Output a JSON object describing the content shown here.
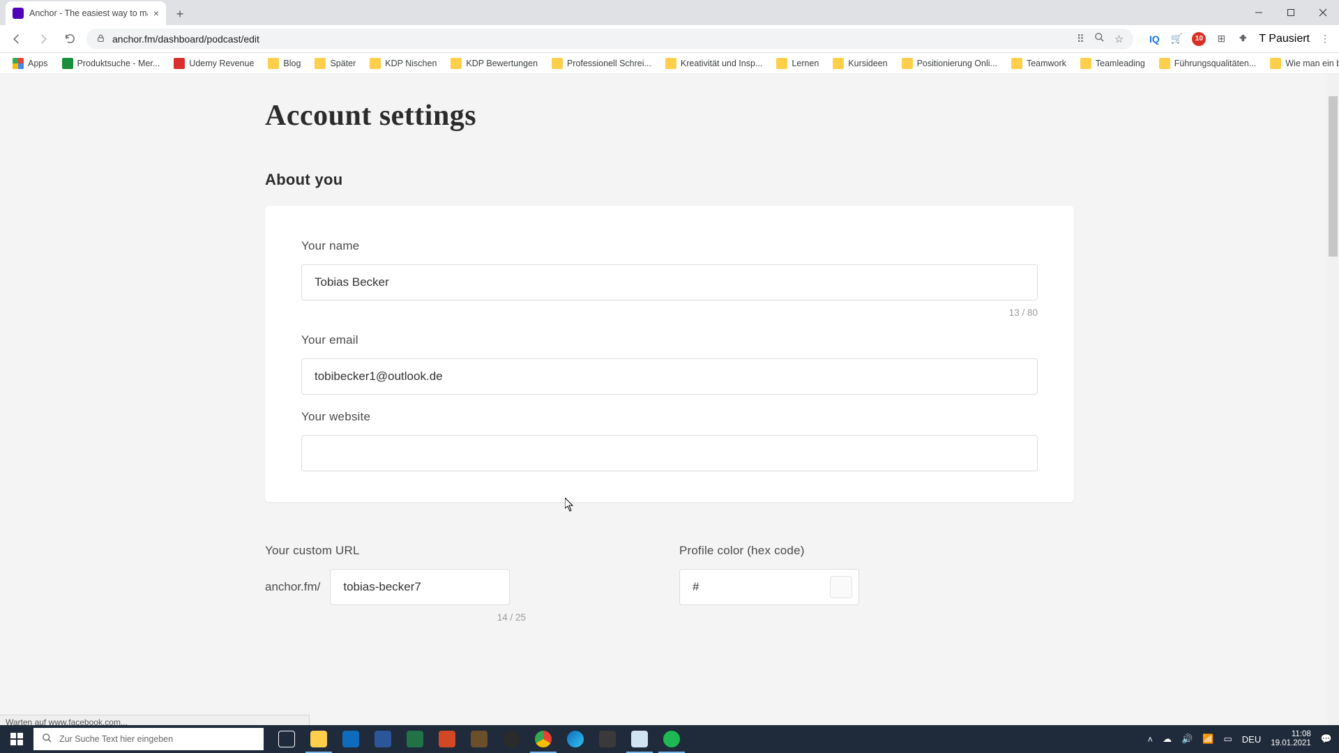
{
  "browser": {
    "tab_title": "Anchor - The easiest way to mak",
    "url": "anchor.fm/dashboard/podcast/edit",
    "profile_badge": "T",
    "profile_label": "Pausiert",
    "bookmarks": [
      {
        "label": "Apps",
        "icon": "apps"
      },
      {
        "label": "Produktsuche - Mer...",
        "icon": "green"
      },
      {
        "label": "Udemy Revenue",
        "icon": "red"
      },
      {
        "label": "Blog",
        "icon": "folder"
      },
      {
        "label": "Später",
        "icon": "folder"
      },
      {
        "label": "KDP Nischen",
        "icon": "folder"
      },
      {
        "label": "KDP Bewertungen",
        "icon": "folder"
      },
      {
        "label": "Professionell Schrei...",
        "icon": "folder"
      },
      {
        "label": "Kreativität und Insp...",
        "icon": "folder"
      },
      {
        "label": "Lernen",
        "icon": "folder"
      },
      {
        "label": "Kursideen",
        "icon": "folder"
      },
      {
        "label": "Positionierung Onli...",
        "icon": "folder"
      },
      {
        "label": "Teamwork",
        "icon": "folder"
      },
      {
        "label": "Teamleading",
        "icon": "folder"
      },
      {
        "label": "Führungsqualitäten...",
        "icon": "folder"
      },
      {
        "label": "Wie man ein besser...",
        "icon": "folder"
      }
    ],
    "status_text": "Warten auf www.facebook.com..."
  },
  "page": {
    "title": "Account settings",
    "section_about": "About you",
    "name_label": "Your name",
    "name_value": "Tobias Becker",
    "name_counter": "13 / 80",
    "email_label": "Your email",
    "email_value": "tobibecker1@outlook.de",
    "website_label": "Your website",
    "website_value": "",
    "custom_url_label": "Your custom URL",
    "custom_url_prefix": "anchor.fm/",
    "custom_url_value": "tobias-becker7",
    "custom_url_counter": "14 / 25",
    "color_label": "Profile color (hex code)",
    "color_value": "#"
  },
  "taskbar": {
    "search_placeholder": "Zur Suche Text hier eingeben",
    "lang": "DEU",
    "time": "11:08",
    "date": "19.01.2021"
  }
}
